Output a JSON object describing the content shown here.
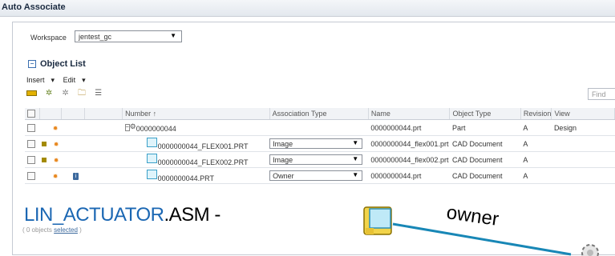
{
  "window": {
    "title": "Auto Associate"
  },
  "workspace": {
    "label": "Workspace",
    "value": "jentest_gc"
  },
  "object_list": {
    "title": "Object List",
    "menus": [
      "Insert",
      "Edit"
    ],
    "find_placeholder": "Find",
    "columns": [
      "Number",
      "Association Type",
      "Name",
      "Object Type",
      "Revision",
      "View"
    ],
    "rows": [
      {
        "number": "0000000044",
        "assoc": "",
        "name": "0000000044.prt",
        "type": "Part",
        "rev": "A",
        "view": "Design"
      },
      {
        "number": "0000000044_FLEX001.PRT",
        "assoc": "Image",
        "name": "0000000044_flex001.prt",
        "type": "CAD Document",
        "rev": "A",
        "view": ""
      },
      {
        "number": "0000000044_FLEX002.PRT",
        "assoc": "Image",
        "name": "0000000044_flex002.prt",
        "type": "CAD Document",
        "rev": "A",
        "view": ""
      },
      {
        "number": "0000000044.PRT",
        "assoc": "Owner",
        "name": "0000000044.prt",
        "type": "CAD Document",
        "rev": "A",
        "view": ""
      }
    ],
    "footer_prefix": "( 0 objects ",
    "footer_link": "selected",
    "footer_suffix": " )"
  },
  "annotation": {
    "lin": "LIN_ACTUATOR",
    "asm": ".ASM -",
    "owner": "owner"
  },
  "colors": {
    "accent": "#1b67b3",
    "connector": "#1887b6",
    "header": "#1a2a40"
  }
}
